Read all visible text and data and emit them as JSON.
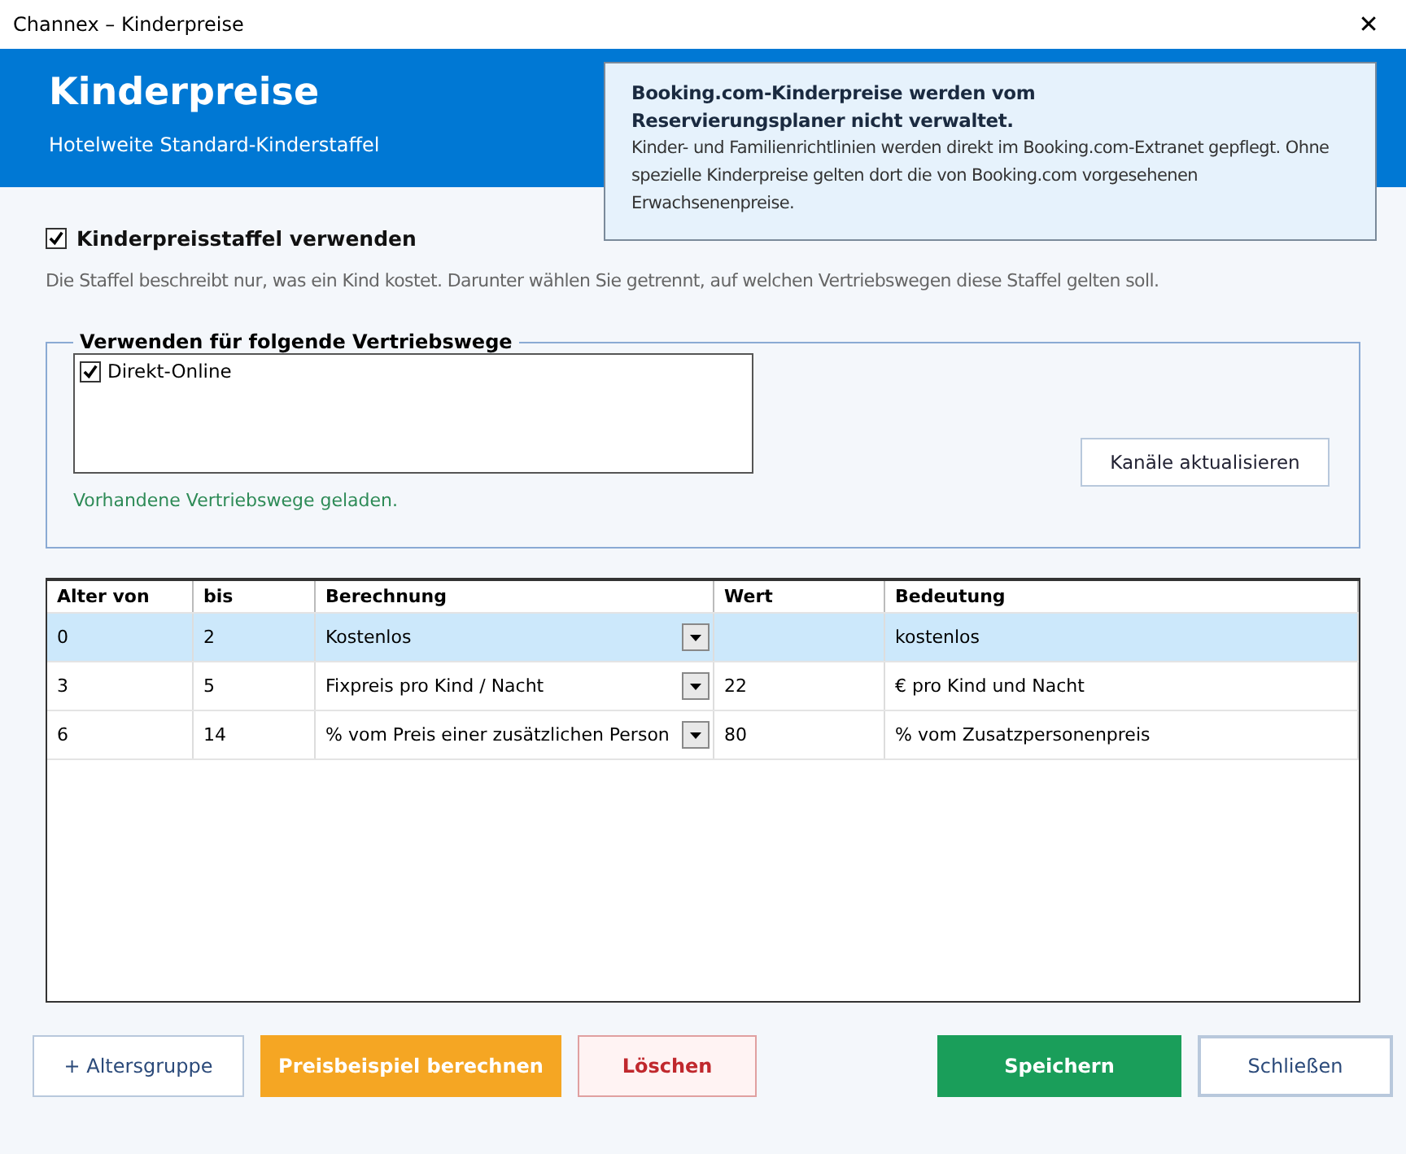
{
  "window": {
    "title": "Channex – Kinderpreise",
    "close": "✕"
  },
  "header": {
    "title": "Kinderpreise",
    "subtitle": "Hotelweite Standard-Kinderstaffel"
  },
  "info": {
    "title": "Booking.com-Kinderpreise werden vom Reservierungsplaner nicht verwaltet.",
    "text": "Kinder- und Familienrichtlinien werden direkt im Booking.com-Extranet gepflegt. Ohne spezielle Kinderpreise gelten dort die von Booking.com vorgesehenen Erwachsenenpreise."
  },
  "use_scale": {
    "label": "Kinderpreisstaffel verwenden",
    "checked": true
  },
  "description": "Die Staffel beschreibt nur, was ein Kind kostet. Darunter wählen Sie getrennt, auf welchen Vertriebswegen diese Staffel gelten soll.",
  "channels": {
    "legend": "Verwenden für folgende Vertriebswege",
    "items": [
      {
        "label": "Direkt-Online",
        "checked": true
      }
    ],
    "refresh_button": "Kanäle aktualisieren",
    "status": "Vorhandene Vertriebswege geladen."
  },
  "table": {
    "columns": [
      "Alter von",
      "bis",
      "Berechnung",
      "Wert",
      "Bedeutung"
    ],
    "rows": [
      {
        "from": "0",
        "to": "2",
        "calc": "Kostenlos",
        "value": "",
        "meaning": "kostenlos",
        "selected": true
      },
      {
        "from": "3",
        "to": "5",
        "calc": "Fixpreis pro Kind / Nacht",
        "value": "22",
        "meaning": "€ pro Kind und Nacht",
        "selected": false
      },
      {
        "from": "6",
        "to": "14",
        "calc": "% vom Preis einer zusätzlichen Person",
        "value": "80",
        "meaning": "% vom Zusatzpersonenpreis",
        "selected": false
      }
    ]
  },
  "buttons": [
    {
      "label": "+ Altersgruppe",
      "kind": "outline"
    },
    {
      "label": "Preisbeispiel berechnen",
      "kind": "warning"
    },
    {
      "label": "Löschen",
      "kind": "danger"
    },
    {
      "label": "Speichern",
      "kind": "primary"
    },
    {
      "label": "Schließen",
      "kind": "secondary"
    }
  ]
}
